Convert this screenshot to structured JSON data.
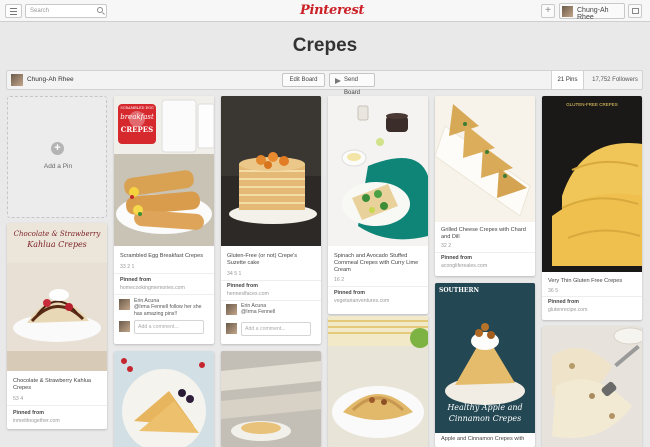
{
  "header": {
    "search_placeholder": "Search",
    "logo": "Pinterest",
    "user_name": "Chung-Ah Rhee",
    "plus": "+"
  },
  "board": {
    "title": "Crepes",
    "owner": "Chung-Ah Rhee",
    "edit_label": "Edit Board",
    "send_label": "Send Board",
    "pins_count": "21 Pins",
    "followers_count": "17,752 Followers"
  },
  "add_pin": {
    "label": "Add a Pin",
    "plus": "+"
  },
  "pins": [
    {
      "description": "Scrambled Egg Breakfast Crepes",
      "stats": "33   2   1",
      "pinned_label": "Pinned from",
      "source": "homecookingmemories.com",
      "commenter": "Erin Acuna",
      "comment": "@Irma Fennell follow her she has amazing pins!!",
      "comment_placeholder": "Add a comment...",
      "overlay_top": "SCRAMBLED EGG",
      "overlay_mid": "breakfast",
      "overlay_bottom": "CREPES"
    },
    {
      "description": "Gluten-Free (or not) Crepe's Suzette cake",
      "stats": "34   5   1",
      "pinned_label": "Pinned from",
      "source": "henneslfaces.com",
      "commenter": "Erin Acuna",
      "comment": "@Irma Fennell",
      "comment_placeholder": "Add a comment..."
    },
    {
      "description": "Spinach and Avocado Stuffed Cornmeal Crepes with Curry Lime Cream",
      "stats": "16   2",
      "pinned_label": "Pinned from",
      "source": "vegetarianventures.com"
    },
    {
      "description": "Grilled Cheese Crepes with Chard and Dill",
      "stats": "32   2",
      "pinned_label": "Pinned from",
      "source": "aconglifereales.com"
    },
    {
      "description": "Very Thin Gluten Free Crepes",
      "stats": "36   5",
      "pinned_label": "Pinned from",
      "source": "glutenrecipe.com",
      "overlay_top": "GLUTEN-FREE CREPES"
    },
    {
      "description": "Chocolate & Strawberry Kahlua Crepes",
      "stats": "53   4",
      "pinned_label": "Pinned from",
      "source": "inmeittoogether.com",
      "overlay_top": "Chocolate & Strawberry",
      "overlay_mid": "Kahlua Crepes"
    },
    {
      "description": "Apple and Cinnamon Crepes with",
      "overlay_top": "SOUTHERN",
      "overlay_mid": "Healthy Apple and",
      "overlay_bottom": "Cinnamon Crepes"
    }
  ]
}
